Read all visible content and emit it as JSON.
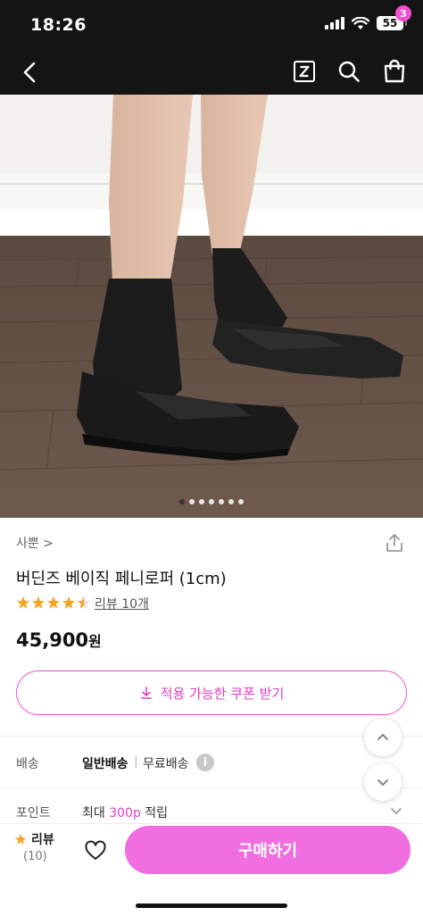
{
  "status_bar": {
    "time": "18:26",
    "battery": "55"
  },
  "nav": {
    "icons": [
      "back-arrow-icon",
      "zigzag-z-icon",
      "search-icon",
      "shopping-bag-icon"
    ],
    "cart_count": "3"
  },
  "hero": {
    "image_description": "photo of legs in black socks wearing black penny loafers on wooden floor",
    "page_count": 7,
    "current_page": 1
  },
  "product": {
    "brand": "사뿐 >",
    "name": "버딘즈 베이직 페니로퍼 (1cm)",
    "rating": 4.5,
    "review_link": "리뷰 10개",
    "price": "45,900",
    "price_unit": "원"
  },
  "coupon": {
    "label": "적용 가능한 쿠폰 받기"
  },
  "shipping": {
    "label": "배송",
    "type": "일반배송",
    "separator": "|",
    "fee": "무료배송",
    "info_icon": "i"
  },
  "points": {
    "label": "포인트",
    "prefix": "최대 ",
    "amount": "300p",
    "suffix": " 적립"
  },
  "bottom_bar": {
    "review_label": "리뷰",
    "review_count": "(10)",
    "buy_label": "구매하기"
  },
  "colors": {
    "accent": "#f04fd0",
    "buy_button": "#f06ee0",
    "star": "#f5a623"
  }
}
